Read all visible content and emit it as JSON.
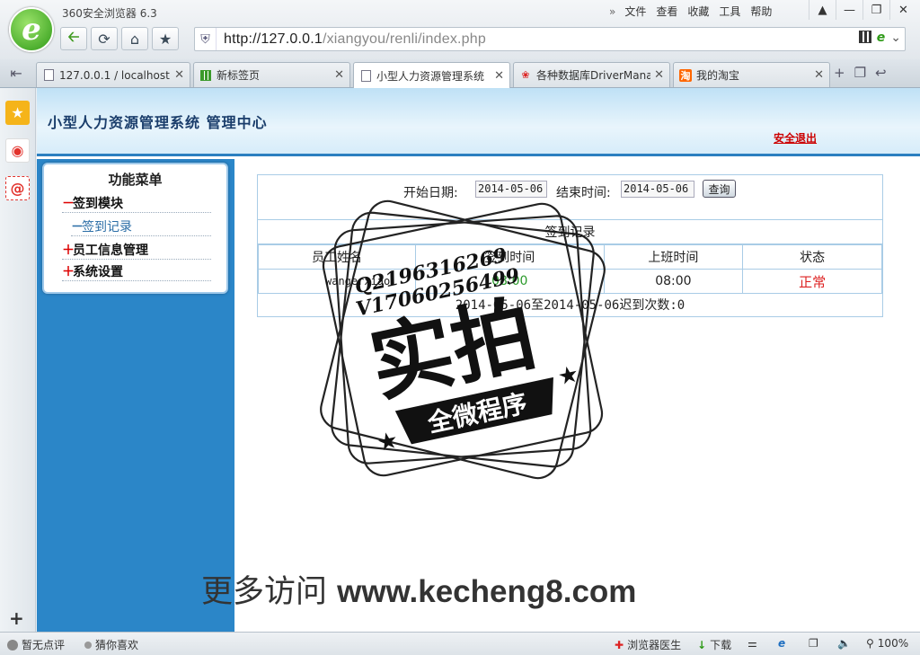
{
  "browser": {
    "title": "360安全浏览器 6.3",
    "menu": {
      "dblarrow": "»",
      "file": "文件",
      "view": "查看",
      "favorites": "收藏",
      "tools": "工具",
      "help": "帮助"
    },
    "url_host": "http://127.0.0.1",
    "url_path": "/xiangyou/renli/index.php",
    "tabs": [
      {
        "label": "127.0.0.1 / localhost"
      },
      {
        "label": "新标签页"
      },
      {
        "label": "小型人力资源管理系统"
      },
      {
        "label": "各种数据库DriverManager"
      },
      {
        "label": "我的淘宝"
      }
    ]
  },
  "page": {
    "system_title": "小型人力资源管理系统  管理中心",
    "logout": "安全退出",
    "menu_title": "功能菜单",
    "menu": [
      {
        "sym": "－",
        "label": "签到模块"
      },
      {
        "sym": "－",
        "label": "签到记录"
      },
      {
        "sym": "＋",
        "label": "员工信息管理"
      },
      {
        "sym": "＋",
        "label": " 系统设置"
      }
    ],
    "query": {
      "start_label": "开始日期:",
      "start_value": "2014-05-06",
      "end_label": "结束时间:",
      "end_value": "2014-05-06",
      "button": "查询"
    },
    "table": {
      "caption": "签到记录",
      "headers": [
        "员工姓名",
        "签到时间",
        "上班时间",
        "状态"
      ],
      "rows": [
        {
          "name": "wangerxiao",
          "sign_time": "08:00",
          "work_time": "08:00",
          "status": "正常"
        }
      ],
      "summary": "2014-05-06至2014-05-06迟到次数:0"
    }
  },
  "statusbar": {
    "no_rating": "暂无点评",
    "guess": "猜你喜欢",
    "doctor": "浏览器医生",
    "download": "下载",
    "zoom": "100%"
  },
  "watermark": {
    "qq": "Q2196316269",
    "wechat": "V17060256499",
    "stamp_main": "实拍",
    "stamp_banner": "全微程序",
    "promo_cn": "更多访问",
    "promo_url": "www.kecheng8.com"
  }
}
